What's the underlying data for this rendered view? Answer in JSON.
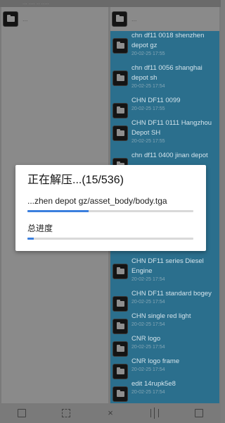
{
  "top_bar_text": "... .... .. .....",
  "left_pane": {
    "up_label": "..."
  },
  "right_pane": {
    "up_label": "...",
    "files": [
      {
        "name": "chn df11 0018 shenzhen depot gz",
        "date": "20-02-25 17:55"
      },
      {
        "name": "chn df11 0056 shanghai depot sh",
        "date": "20-02-25 17:54"
      },
      {
        "name": "CHN DF11 0099",
        "date": "20-02-25 17:55"
      },
      {
        "name": "CHN DF11 0111 Hangzhou Depot SH",
        "date": "20-02-25 17:55"
      },
      {
        "name": "chn df11 0400 jinan depot",
        "date": ""
      },
      {
        "name": "CHN DF11 series Diesel Engine",
        "date": "20-02-25 17:54"
      },
      {
        "name": "CHN DF11 standard bogey",
        "date": "20-02-25 17:54"
      },
      {
        "name": "CHN single red light",
        "date": "20-02-25 17:54"
      },
      {
        "name": "CNR logo",
        "date": "20-02-25 17:54"
      },
      {
        "name": "CNR logo frame",
        "date": "20-02-25 17:54"
      },
      {
        "name": "edit 14rupk5e8",
        "date": "20-02-25 17:54"
      }
    ]
  },
  "dialog": {
    "title": "正在解压...(15/536)",
    "current_file": "...zhen depot gz/asset_body/body.tga",
    "current_progress": 0.37,
    "total_label": "总进度",
    "total_progress": 0.04
  },
  "bottom_toolbar": {
    "icons": [
      "select-all-icon",
      "copy-icon",
      "close-icon",
      "split-icon",
      "list-icon"
    ],
    "close_glyph": "×"
  },
  "colors": {
    "accent": "#3b7fde",
    "selected_pane": "#2b6f8d",
    "overlay_gray": "#7a7a7a"
  }
}
